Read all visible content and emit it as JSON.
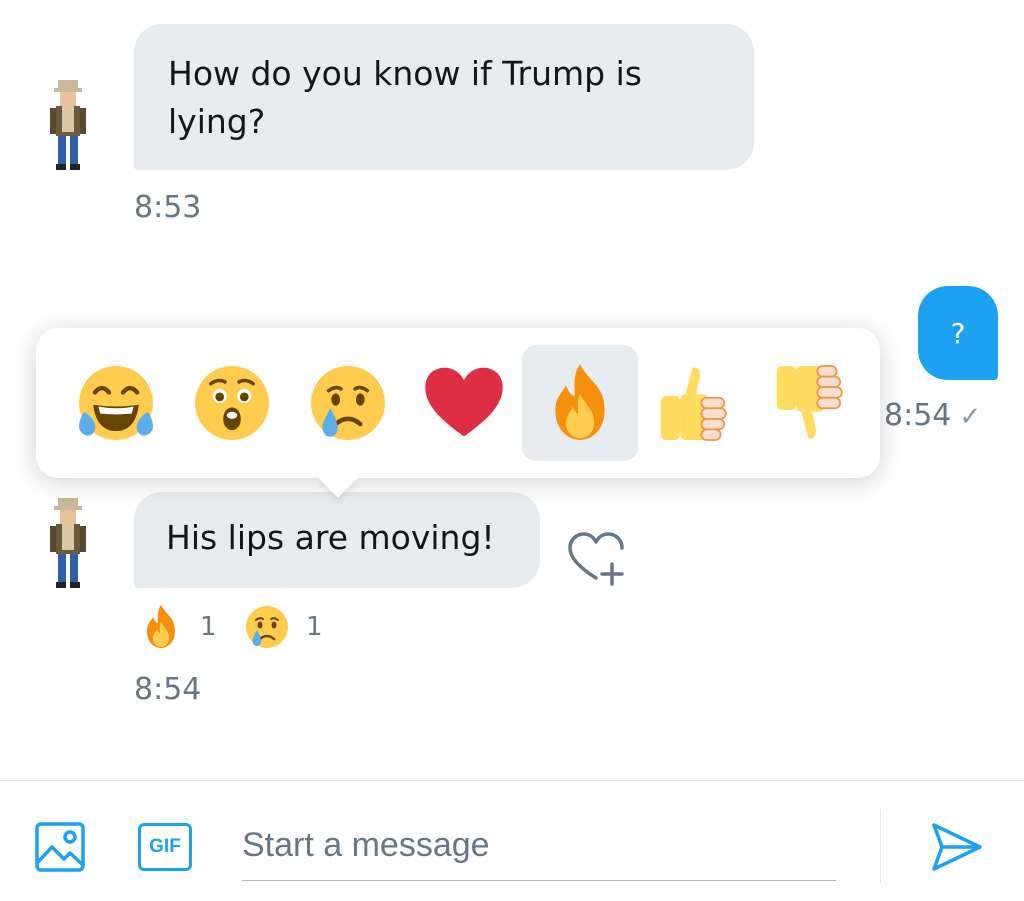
{
  "messages": [
    {
      "text": "How do you know if Trump is lying?",
      "time": "8:53"
    },
    {
      "text": "?",
      "time": "8:54",
      "status": "sent-check"
    },
    {
      "text": "His lips are moving!",
      "time": "8:54"
    }
  ],
  "reaction_picker": {
    "options": [
      "laughing-tears",
      "surprised",
      "crying",
      "heart",
      "fire",
      "thumbs-up",
      "thumbs-down"
    ],
    "selected": "fire"
  },
  "reactions": [
    {
      "icon": "fire",
      "count": "1"
    },
    {
      "icon": "crying",
      "count": "1"
    }
  ],
  "composer": {
    "placeholder": "Start a message",
    "gif_label": "GIF"
  },
  "colors": {
    "accent": "#1da1f2",
    "bubble_in": "#e6ecf0"
  }
}
